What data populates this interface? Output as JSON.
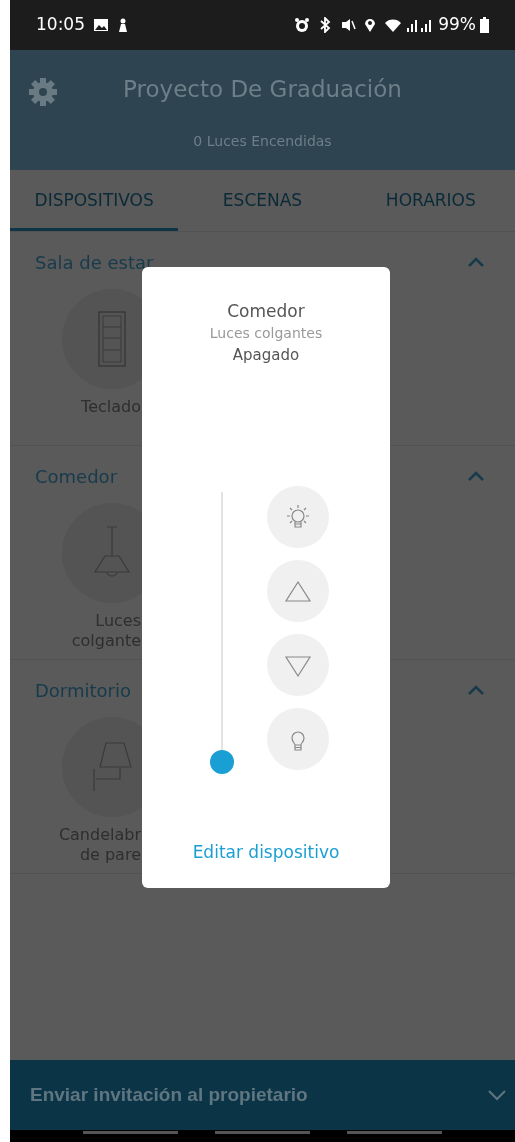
{
  "status_bar": {
    "time": "10:05",
    "battery": "99%"
  },
  "header": {
    "title": "Proyecto De Graduación",
    "subtitle": "0 Luces Encendidas"
  },
  "tabs": [
    {
      "label": "DISPOSITIVOS",
      "selected": true
    },
    {
      "label": "ESCENAS",
      "selected": false
    },
    {
      "label": "HORARIOS",
      "selected": false
    }
  ],
  "rooms": [
    {
      "name": "Sala de estar",
      "expanded": true,
      "devices": [
        {
          "kind": "keypad",
          "label_lines": [
            "Teclado"
          ]
        }
      ]
    },
    {
      "name": "Comedor",
      "expanded": true,
      "devices": [
        {
          "kind": "pendant",
          "label_lines": [
            "Luces",
            "colgante"
          ]
        }
      ]
    },
    {
      "name": "Dormitorio",
      "expanded": true,
      "devices": [
        {
          "kind": "sconce",
          "label_lines": [
            "Candelabr",
            "de pare"
          ]
        }
      ]
    }
  ],
  "dialog": {
    "room": "Comedor",
    "device": "Luces colgantes",
    "state": "Apagado",
    "level": 0,
    "controls": [
      {
        "kind": "bright"
      },
      {
        "kind": "up"
      },
      {
        "kind": "down"
      },
      {
        "kind": "dim"
      }
    ],
    "link": "Editar dispositivo"
  },
  "footer": {
    "label": "Enviar invitación al propietario"
  }
}
